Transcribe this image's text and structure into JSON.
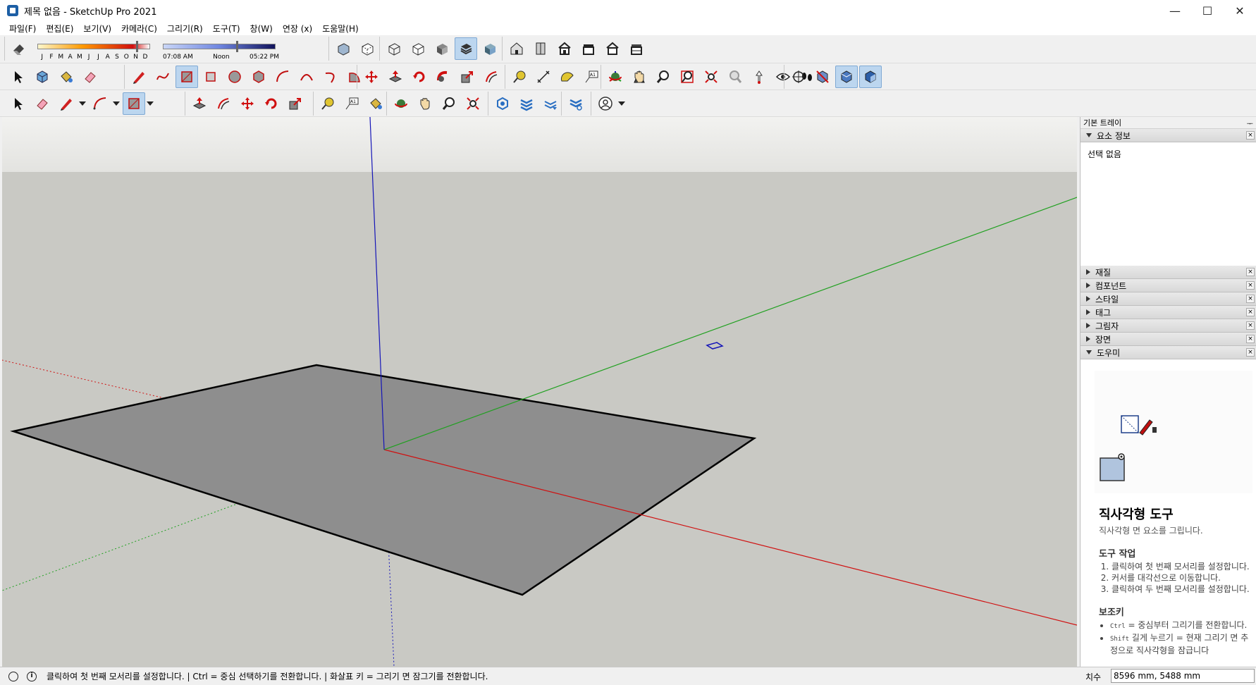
{
  "window": {
    "title": "제목 없음 - SketchUp Pro 2021",
    "minimize": "—",
    "maximize": "☐",
    "close": "✕"
  },
  "menu": [
    "파일(F)",
    "편집(E)",
    "보기(V)",
    "카메라(C)",
    "그리기(R)",
    "도구(T)",
    "창(W)",
    "연장 (x)",
    "도움말(H)"
  ],
  "shadows": {
    "months": [
      "J",
      "F",
      "M",
      "A",
      "M",
      "J",
      "J",
      "A",
      "S",
      "O",
      "N",
      "D"
    ],
    "time_start": "07:08 AM",
    "time_mid": "Noon",
    "time_end": "05:22 PM"
  },
  "tray": {
    "title": "기본 트레이",
    "pin": "ᅮ",
    "entity_info_label": "요소 정보",
    "entity_info_value": "선택 없음",
    "panels": [
      "재질",
      "컴포넌트",
      "스타일",
      "태그",
      "그림자",
      "장면"
    ],
    "instructor_label": "도우미"
  },
  "instructor": {
    "title": "직사각형 도구",
    "subtitle": "직사각형 면 요소를 그립니다.",
    "operation_heading": "도구 작업",
    "steps": [
      "클릭하여 첫 번째 모서리를 설정합니다.",
      "커서를 대각선으로 이동합니다.",
      "클릭하여 두 번째 모서리를 설정합니다."
    ],
    "modifier_heading": "보조키",
    "mod1_key": "Ctrl",
    "mod1_text": " = 중심부터 그리기를 전환합니다.",
    "mod2_key": "Shift",
    "mod2_text": " 길게 누르기 = 현재 그리기 면 추정으로 직사각형을 잠급니다"
  },
  "status": {
    "message": "클릭하여 첫 번째 모서리를 설정합니다. | Ctrl = 중심 선택하기를 전환합니다. | 화살표 키 = 그리기 면 잠그기를 전환합니다.",
    "measurements_label": "치수",
    "measurements_value": "8596 mm, 5488 mm"
  },
  "colors": {
    "axis_red": "#d01010",
    "axis_green": "#1fa01f",
    "axis_blue": "#1515b8",
    "face": "#8e8e8e",
    "sky": "#e6e6e3",
    "ground": "#c9c9c4"
  }
}
